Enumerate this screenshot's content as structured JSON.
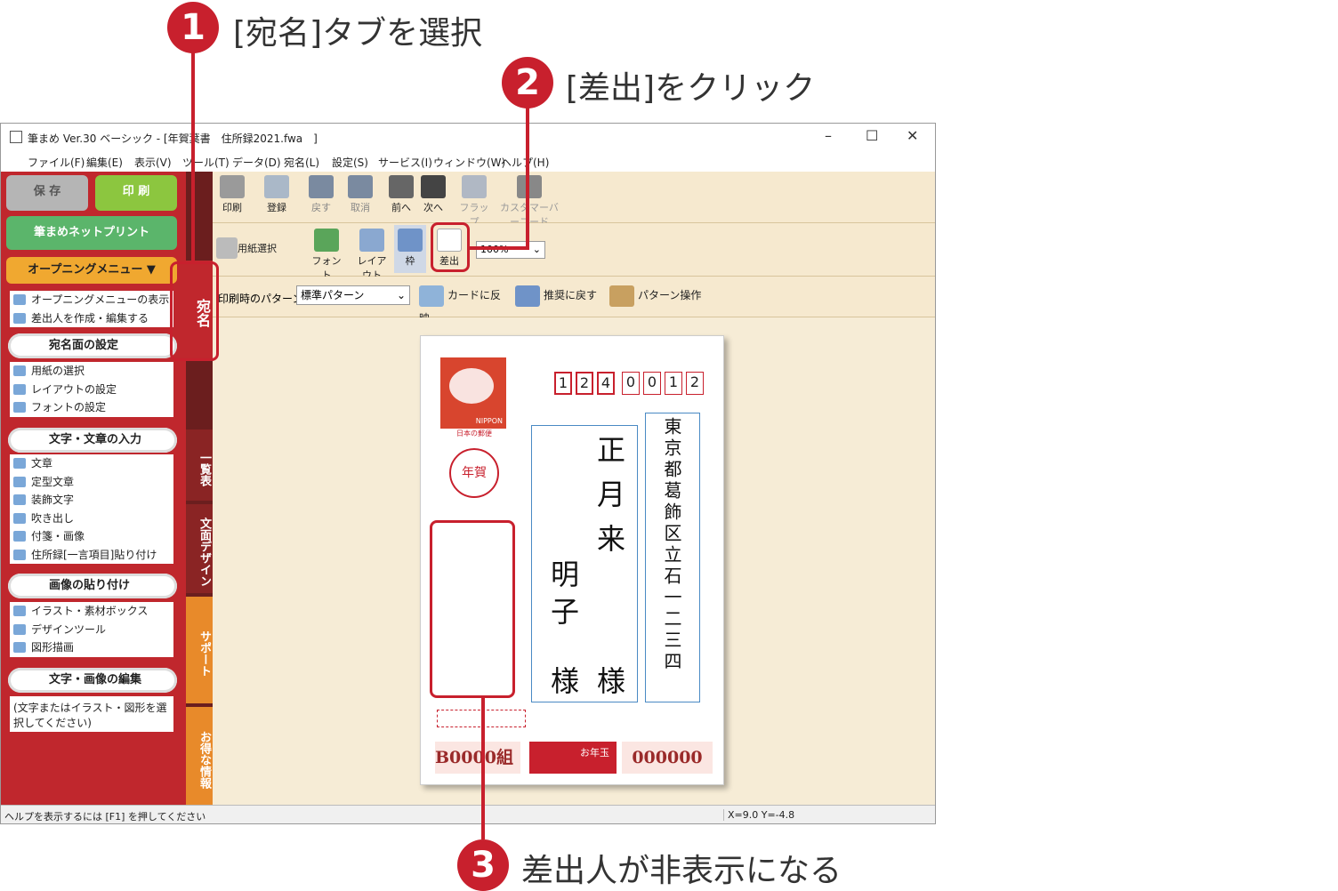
{
  "callouts": [
    {
      "num": "1",
      "text": "[宛名]タブを選択"
    },
    {
      "num": "2",
      "text": "[差出]をクリック"
    },
    {
      "num": "3",
      "text": "差出人が非表示になる"
    }
  ],
  "window": {
    "title": "筆まめ Ver.30 ベーシック - [年賀葉書　住所録2021.fwa　]",
    "controls": [
      "–",
      "☐",
      "✕"
    ]
  },
  "menu": [
    "ファイル(F)",
    "編集(E)",
    "表示(V)",
    "ツール(T)",
    "データ(D)",
    "宛名(L)",
    "設定(S)",
    "サービス(I)",
    "ウィンドウ(W)",
    "ヘルプ(H)"
  ],
  "left": {
    "save": "保 存",
    "print": "印 刷",
    "netprint": "筆まめネットプリント",
    "opening": "オープニングメニュー",
    "opening_items": [
      "オープニングメニューの表示",
      "差出人を作成・編集する"
    ],
    "sec1": "宛名面の設定",
    "sec1_items": [
      "用紙の選択",
      "レイアウトの設定",
      "フォントの設定"
    ],
    "sec2": "文字・文章の入力",
    "sec2_items": [
      "文章",
      "定型文章",
      "装飾文字",
      "吹き出し",
      "付箋・画像",
      "住所録[一言項目]貼り付け"
    ],
    "sec3": "画像の貼り付け",
    "sec3_items": [
      "イラスト・素材ボックス",
      "デザインツール",
      "図形描画"
    ],
    "sec4": "文字・画像の編集",
    "sec4_note": "(文字またはイラスト・図形を選択してください)"
  },
  "sidetabs": [
    "宛名",
    "一覧表",
    "文面デザイン",
    "サポート",
    "お得な情報"
  ],
  "toolbar1": [
    "印刷",
    "登録",
    "戻す",
    "取消",
    "前へ",
    "次へ",
    "フラップ",
    "カスタマーバーコード"
  ],
  "toolbar2": {
    "paper": "用紙選択",
    "font": "フォント",
    "layout": "レイアウト",
    "frame": "枠",
    "sender": "差出",
    "zoom": "100%"
  },
  "toolbar3": {
    "pattern_label": "印刷時のパターン",
    "pattern_value": "標準パターン",
    "reflect": "カードに反映",
    "recommend": "推奨に戻す",
    "pattern_op": "パターン操作"
  },
  "card": {
    "zip": [
      "1",
      "2",
      "4",
      "0",
      "0",
      "1",
      "2"
    ],
    "stamp_text": "NIPPON",
    "stamp_sub": "日本の郵便",
    "nenga": "年賀",
    "address": "東京都葛飾区立石一二三四",
    "name1": "正月来",
    "name2": "明子",
    "honorific": "様",
    "lottery_left": "B0000組",
    "lottery_mid": "お年玉",
    "lottery_right": "000000"
  },
  "status": {
    "help": "ヘルプを表示するには [F1] を押してください",
    "coords": "X=9.0 Y=-4.8"
  },
  "colors": {
    "accent": "#c8202d",
    "panel": "#c0272d",
    "toolbar": "#f6e9cf"
  }
}
